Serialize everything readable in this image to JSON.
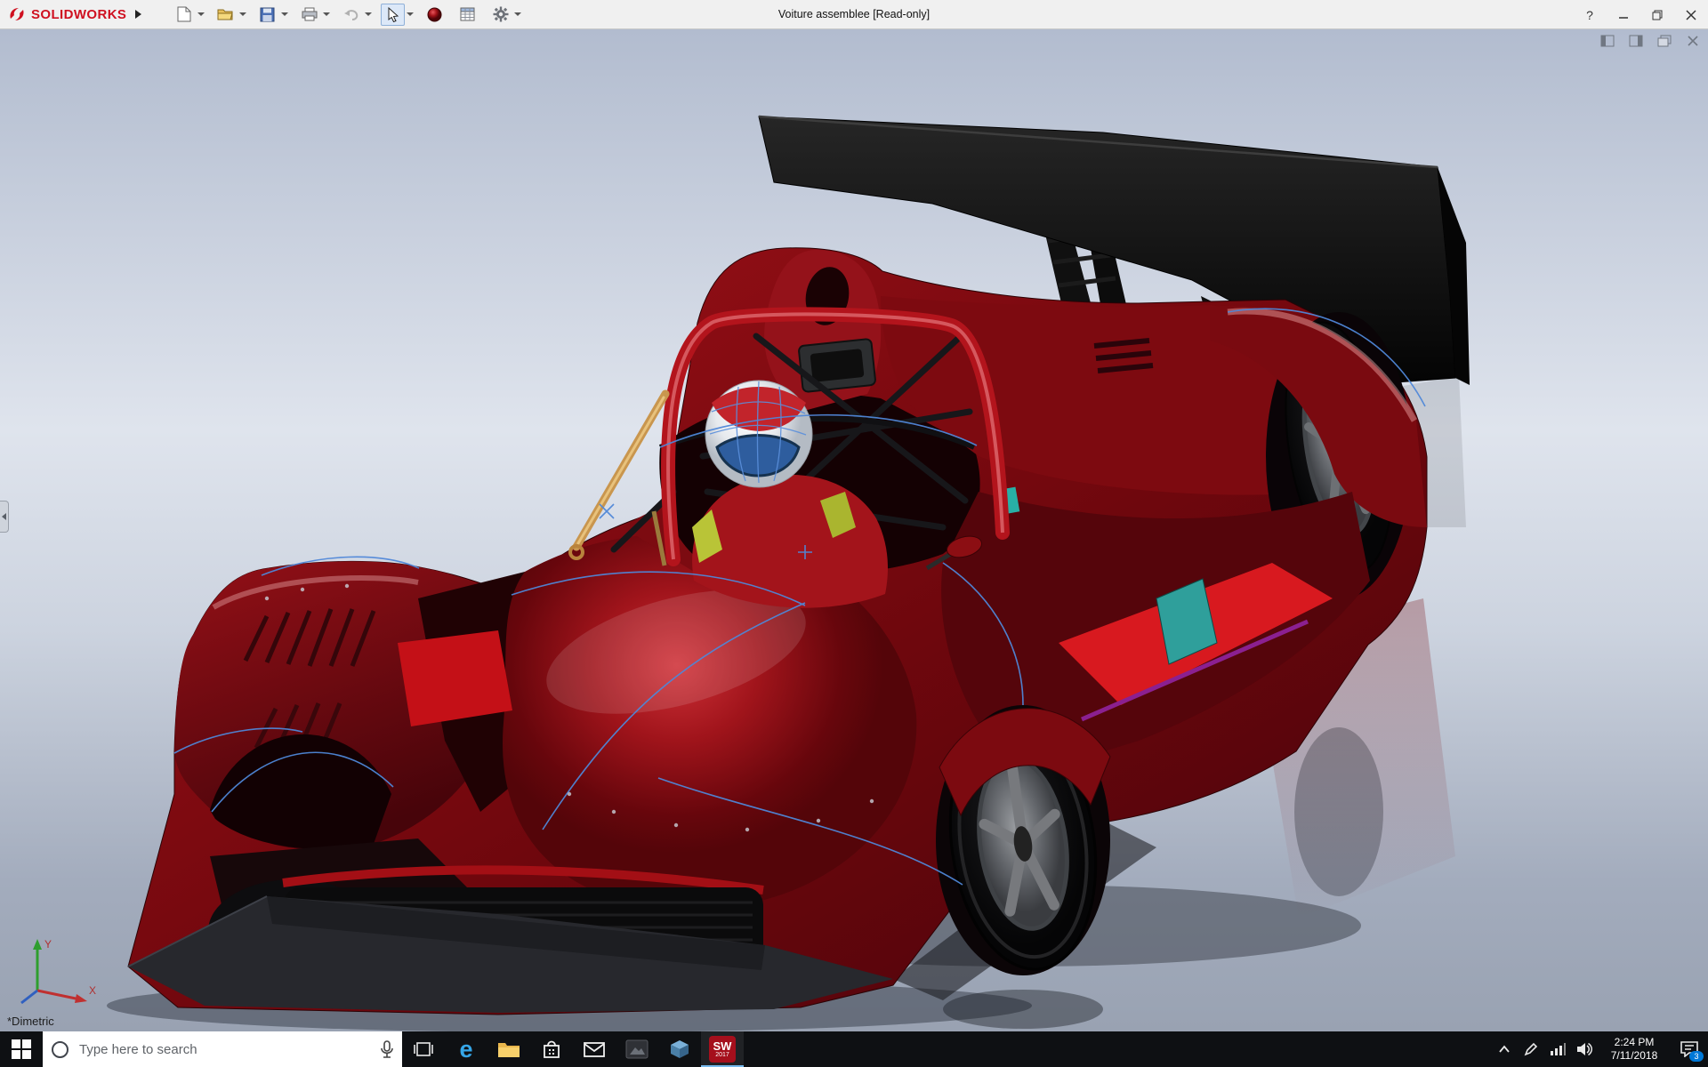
{
  "titlebar": {
    "brand": "SOLIDWORKS",
    "title": "Voiture assemblee [Read-only]",
    "help_label": "?"
  },
  "toolbar": {
    "buttons": [
      "new-document",
      "open",
      "save",
      "print",
      "undo",
      "select",
      "appearance",
      "design-table",
      "options"
    ]
  },
  "viewport": {
    "view_label": "*Dimetric",
    "triad": {
      "x_label": "X",
      "y_label": "Y"
    }
  },
  "taskbar": {
    "search_placeholder": "Type here to search",
    "edge_glyph": "e",
    "sw_badge": {
      "line1": "SW",
      "line2": "2017"
    },
    "clock": {
      "time": "2:24 PM",
      "date": "7/11/2018"
    },
    "action_badge": "3"
  },
  "colors": {
    "car_body": "#7a0a0e",
    "car_accent": "#c41017",
    "wing": "#0a0a0a",
    "background_top": "#b6bfd2",
    "taskbar_bg": "#0e1013",
    "brand_red": "#cf1020"
  }
}
